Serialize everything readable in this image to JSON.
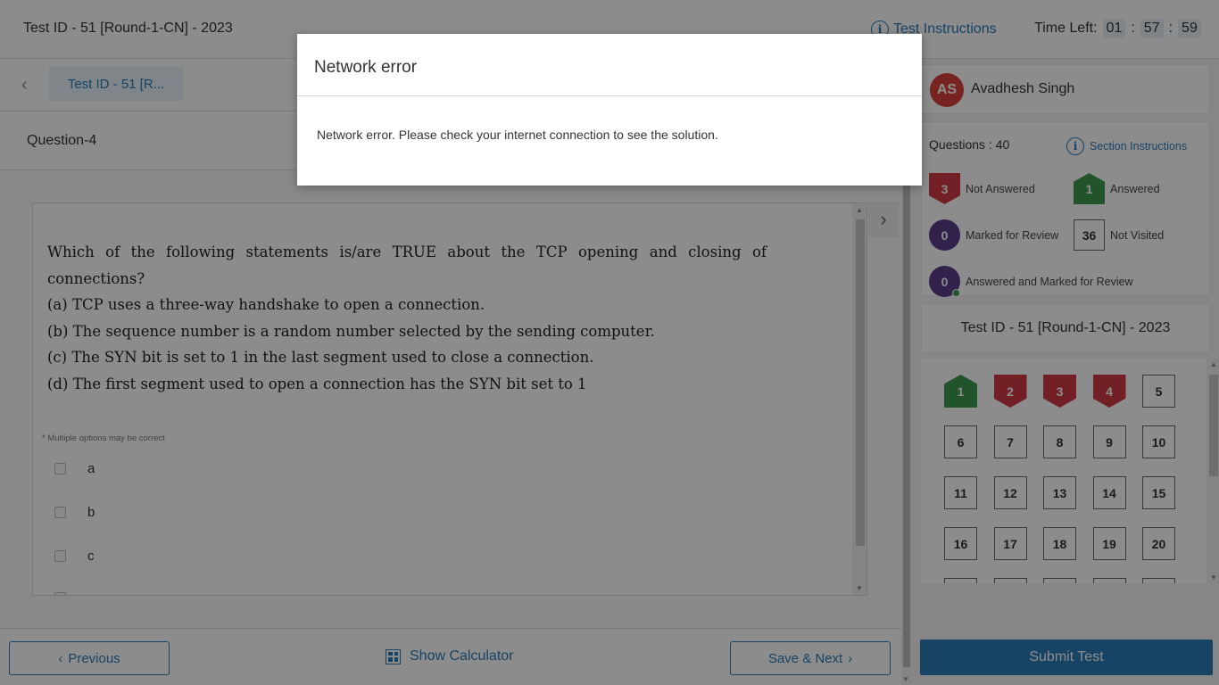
{
  "header": {
    "test_title": "Test ID - 51 [Round-1-CN] - 2023",
    "instructions_label": "Test Instructions",
    "time_left_label": "Time Left:",
    "timer": {
      "hours": "01",
      "minutes": "57",
      "seconds": "59",
      "separator": ":"
    }
  },
  "subheader": {
    "test_tab_label": "Test ID - 51 [R..."
  },
  "question": {
    "label": "Question-4",
    "text_lines": [
      "Which of the following statements is/are TRUE about the TCP opening and closing of connections?",
      "(a) TCP uses a three-way handshake to open a connection.",
      "(b) The sequence number is a random number selected by the sending computer.",
      "(c) The SYN bit is set to 1 in the last segment used to close a connection.",
      "(d) The first segment used to open a connection has the SYN bit set to 1"
    ],
    "hint": "* Multiple options may be correct",
    "options": [
      "a",
      "b",
      "c"
    ]
  },
  "footer": {
    "previous_label": "Previous",
    "calculator_label": "Show Calculator",
    "save_next_label": "Save & Next"
  },
  "sidebar": {
    "user_initials": "AS",
    "user_name": "Avadhesh Singh",
    "questions_count_label": "Questions : 40",
    "section_instructions_label": "Section Instructions",
    "legend": {
      "not_answered": {
        "count": "3",
        "label": "Not Answered"
      },
      "answered": {
        "count": "1",
        "label": "Answered"
      },
      "marked": {
        "count": "0",
        "label": "Marked for Review"
      },
      "not_visited": {
        "count": "36",
        "label": "Not Visited"
      },
      "answered_marked": {
        "count": "0",
        "label": "Answered and Marked for Review"
      }
    },
    "section_title": "Test ID - 51 [Round-1-CN] - 2023",
    "palette": [
      {
        "num": "1",
        "status": "answered"
      },
      {
        "num": "2",
        "status": "not_answered"
      },
      {
        "num": "3",
        "status": "not_answered"
      },
      {
        "num": "4",
        "status": "not_answered"
      },
      {
        "num": "5",
        "status": "not_visited"
      },
      {
        "num": "6",
        "status": "not_visited"
      },
      {
        "num": "7",
        "status": "not_visited"
      },
      {
        "num": "8",
        "status": "not_visited"
      },
      {
        "num": "9",
        "status": "not_visited"
      },
      {
        "num": "10",
        "status": "not_visited"
      },
      {
        "num": "11",
        "status": "not_visited"
      },
      {
        "num": "12",
        "status": "not_visited"
      },
      {
        "num": "13",
        "status": "not_visited"
      },
      {
        "num": "14",
        "status": "not_visited"
      },
      {
        "num": "15",
        "status": "not_visited"
      },
      {
        "num": "16",
        "status": "not_visited"
      },
      {
        "num": "17",
        "status": "not_visited"
      },
      {
        "num": "18",
        "status": "not_visited"
      },
      {
        "num": "19",
        "status": "not_visited"
      },
      {
        "num": "20",
        "status": "not_visited"
      }
    ],
    "submit_label": "Submit Test"
  },
  "modal": {
    "title": "Network error",
    "message": "Network error. Please check your internet connection to see the solution."
  },
  "colors": {
    "accent": "#2a7ab8",
    "not_answered": "#d23a46",
    "answered": "#3e9a4f",
    "marked": "#5c3c89"
  }
}
